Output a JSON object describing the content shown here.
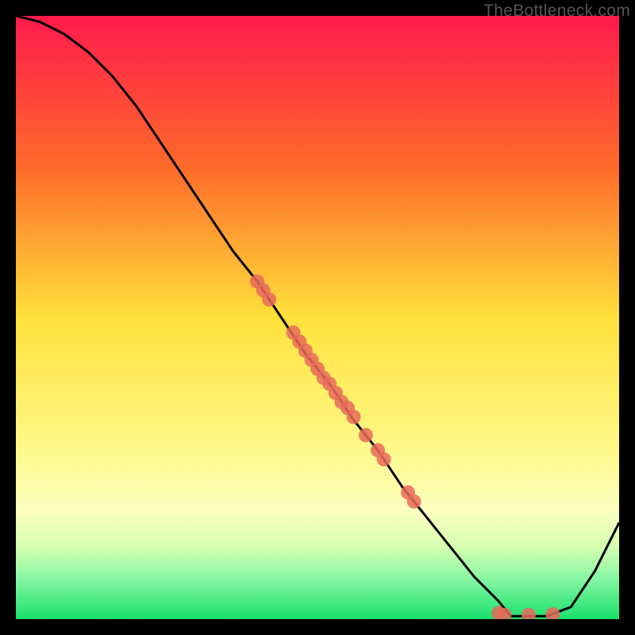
{
  "watermark": "TheBottleneck.com",
  "chart_data": {
    "type": "line",
    "title": "",
    "xlabel": "",
    "ylabel": "",
    "xlim": [
      0,
      100
    ],
    "ylim": [
      0,
      100
    ],
    "grid": false,
    "legend": false,
    "gradient_stops": [
      {
        "offset": 0,
        "color": "#ff1a4d"
      },
      {
        "offset": 25,
        "color": "#ff6a2a"
      },
      {
        "offset": 50,
        "color": "#ffe13a"
      },
      {
        "offset": 72,
        "color": "#fff98a"
      },
      {
        "offset": 82,
        "color": "#fcffc0"
      },
      {
        "offset": 88,
        "color": "#d6ffb0"
      },
      {
        "offset": 93,
        "color": "#8cf7a5"
      },
      {
        "offset": 100,
        "color": "#18e06c"
      }
    ],
    "series": [
      {
        "name": "bottleneck-curve",
        "x": [
          0,
          4,
          8,
          12,
          16,
          20,
          24,
          28,
          32,
          36,
          40,
          44,
          48,
          52,
          56,
          60,
          64,
          68,
          72,
          76,
          80,
          82,
          84,
          88,
          92,
          96,
          100
        ],
        "y": [
          100,
          99,
          97,
          94,
          90,
          85,
          79,
          73,
          67,
          61,
          56,
          50,
          44,
          39,
          33,
          28,
          22,
          17,
          12,
          7,
          3,
          0.5,
          0.5,
          0.5,
          2,
          8,
          16
        ]
      }
    ],
    "scatter": {
      "name": "marker-points",
      "color": "#e76a5b",
      "radius": 9,
      "points": [
        {
          "x": 40,
          "y": 56
        },
        {
          "x": 41,
          "y": 54.5
        },
        {
          "x": 42,
          "y": 53
        },
        {
          "x": 46,
          "y": 47.5
        },
        {
          "x": 47,
          "y": 46
        },
        {
          "x": 48,
          "y": 44.5
        },
        {
          "x": 49,
          "y": 43
        },
        {
          "x": 50,
          "y": 41.5
        },
        {
          "x": 51,
          "y": 40
        },
        {
          "x": 52,
          "y": 39
        },
        {
          "x": 53,
          "y": 37.5
        },
        {
          "x": 54,
          "y": 36
        },
        {
          "x": 55,
          "y": 35
        },
        {
          "x": 56,
          "y": 33.5
        },
        {
          "x": 58,
          "y": 30.5
        },
        {
          "x": 60,
          "y": 28
        },
        {
          "x": 61,
          "y": 26.5
        },
        {
          "x": 65,
          "y": 21
        },
        {
          "x": 66,
          "y": 19.5
        },
        {
          "x": 80,
          "y": 1
        },
        {
          "x": 81,
          "y": 0.7
        },
        {
          "x": 85,
          "y": 0.7
        },
        {
          "x": 89,
          "y": 0.8
        }
      ]
    }
  }
}
